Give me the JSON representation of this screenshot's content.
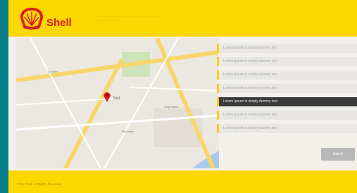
{
  "colors": {
    "accent_yellow": "#fdd700",
    "shell_red": "#dd1d21",
    "teal_background": "#0a7f8c",
    "active_item": "#3a3a3a"
  },
  "header": {
    "brand": "Shell",
    "tagline": "Lorem Ipsum is simply dummy text of the printing and typesetting industry"
  },
  "map": {
    "pin_label": "Shell",
    "places": [
      "Al Kifah",
      "Ramallah",
      "Holy Shrine"
    ]
  },
  "list": {
    "items": [
      "Lorem Ipsum is simply dummy text",
      "Lorem Ipsum is simply dummy text",
      "Lorem Ipsum is simply dummy text",
      "Lorem Ipsum is simply dummy text",
      "Lorem Ipsum is simply dummy text",
      "Lorem Ipsum is simply dummy text",
      "Lorem Ipsum is simply dummy text"
    ],
    "active_index": 4
  },
  "button": {
    "label": "Select"
  },
  "footer": {
    "copyright": "2014 Shell. All Rights Reserved."
  }
}
